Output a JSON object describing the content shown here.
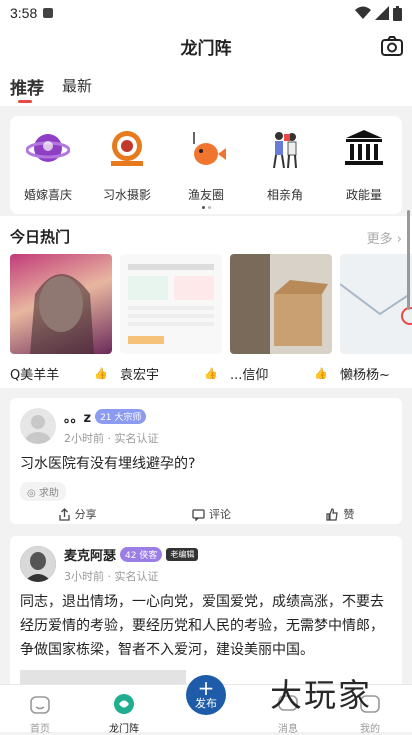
{
  "status_bar": {
    "time": "3:58"
  },
  "header": {
    "title": "龙门阵"
  },
  "tabs": [
    {
      "label": "推荐",
      "active": true
    },
    {
      "label": "最新",
      "active": false
    }
  ],
  "categories": [
    {
      "label": "婚嫁喜庆",
      "icon": "wedding-ring-icon"
    },
    {
      "label": "习水摄影",
      "icon": "camera-lens-icon"
    },
    {
      "label": "渔友圈",
      "icon": "fish-icon"
    },
    {
      "label": "相亲角",
      "icon": "couple-icon"
    },
    {
      "label": "政能量",
      "icon": "government-building-icon"
    }
  ],
  "hot": {
    "title": "今日热门",
    "more_label": "更多",
    "items": [
      {
        "name": "Q美羊羊"
      },
      {
        "name": "袁宏宇"
      },
      {
        "name": "...信仰"
      },
      {
        "name": "懒杨杨~"
      }
    ]
  },
  "posts": [
    {
      "username": "。。z",
      "badge": "21 大宗师",
      "meta": "2小时前 · 实名认证",
      "text": "习水医院有没有埋线避孕的?",
      "tag": "求助",
      "actions": {
        "share": "分享",
        "comment": "评论",
        "like": "赞"
      }
    },
    {
      "username": "麦克阿瑟",
      "badge": "42 侠客",
      "badge2": "老编辑",
      "meta": "3小时前 · 实名认证",
      "text": "同志，退出情场，一心向党，爱国爱党，成绩高涨，不要去经历爱情的考验，要经历党和人民的考验，无需梦中情郎，争做国家栋梁，智者不入爱河，建设美丽中国。"
    }
  ],
  "bottom_nav": [
    {
      "label": "首页",
      "active": false
    },
    {
      "label": "龙门阵",
      "active": true
    },
    {
      "label": "发布",
      "active": false
    },
    {
      "label": "消息",
      "active": false
    },
    {
      "label": "我的",
      "active": false
    }
  ],
  "watermark": "大玩家",
  "colors": {
    "accent": "#e84a43",
    "publish": "#1e5ba8",
    "nav_active": "#1fae8e"
  }
}
